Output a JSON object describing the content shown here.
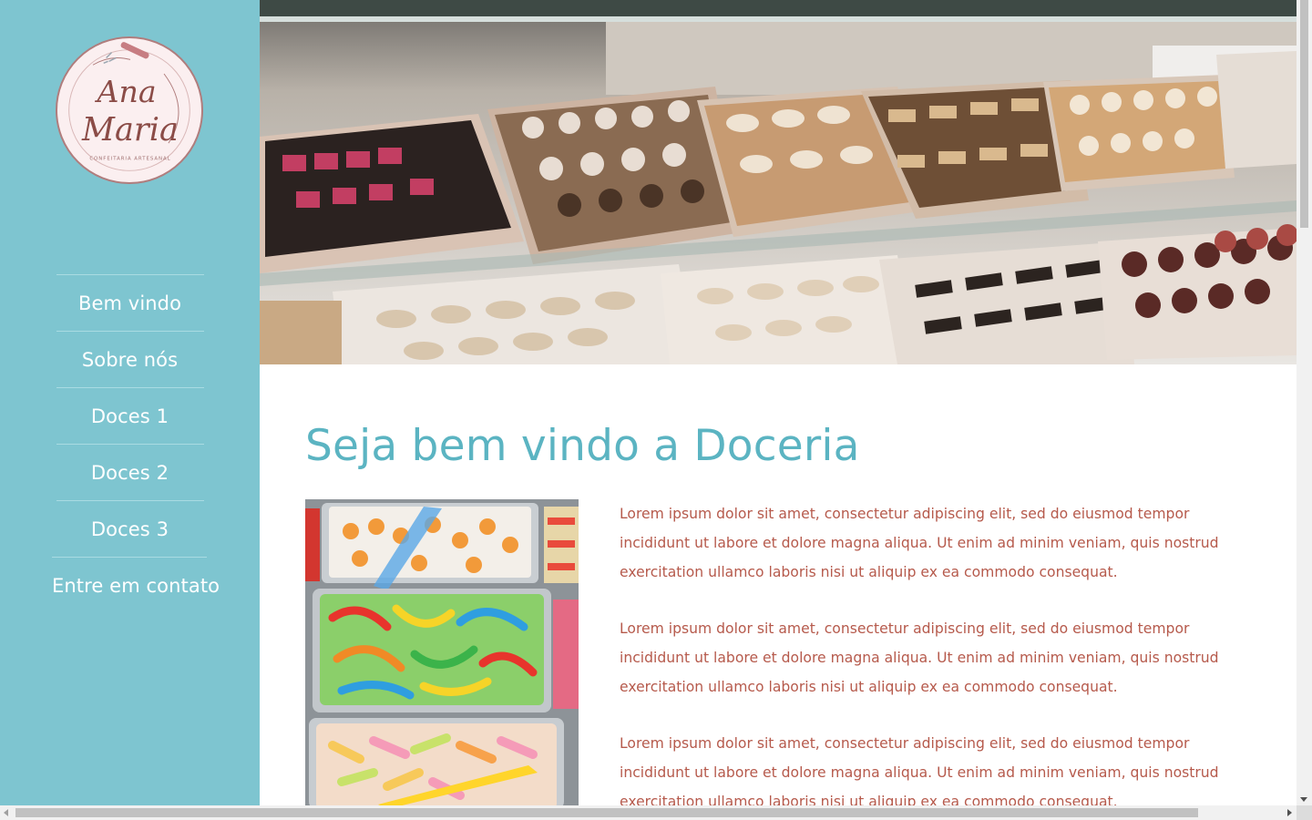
{
  "brand": {
    "logo_line1": "Ana",
    "logo_line2": "Maria",
    "logo_tagline": "CONFEITARIA ARTESANAL",
    "colors": {
      "sidebar": "#7ec5d0",
      "title": "#5bb4c2",
      "text": "#b65a4c",
      "logo_ink": "#8b4c47"
    }
  },
  "nav": {
    "items": [
      {
        "label": "Bem vindo"
      },
      {
        "label": "Sobre nós"
      },
      {
        "label": "Doces 1"
      },
      {
        "label": "Doces 2"
      },
      {
        "label": "Doces 3"
      },
      {
        "label": "Entre em contato"
      }
    ]
  },
  "main": {
    "title": "Seja bem vindo a Doceria",
    "paragraphs": [
      "Lorem ipsum dolor sit amet, consectetur adipiscing elit, sed do eiusmod tempor incididunt ut labore et dolore magna aliqua. Ut enim ad minim veniam, quis nostrud exercitation ullamco laboris nisi ut aliquip ex ea commodo consequat.",
      "Lorem ipsum dolor sit amet, consectetur adipiscing elit, sed do eiusmod tempor incididunt ut labore et dolore magna aliqua. Ut enim ad minim veniam, quis nostrud exercitation ullamco laboris nisi ut aliquip ex ea commodo consequat.",
      "Lorem ipsum dolor sit amet, consectetur adipiscing elit, sed do eiusmod tempor incididunt ut labore et dolore magna aliqua. Ut enim ad minim veniam, quis nostrud exercitation ullamco laboris nisi ut aliquip ex ea commodo consequat."
    ]
  },
  "icons": {
    "scroll_up": "chevron-up-icon",
    "scroll_down": "chevron-down-icon",
    "scroll_left": "chevron-left-icon",
    "scroll_right": "chevron-right-icon"
  }
}
